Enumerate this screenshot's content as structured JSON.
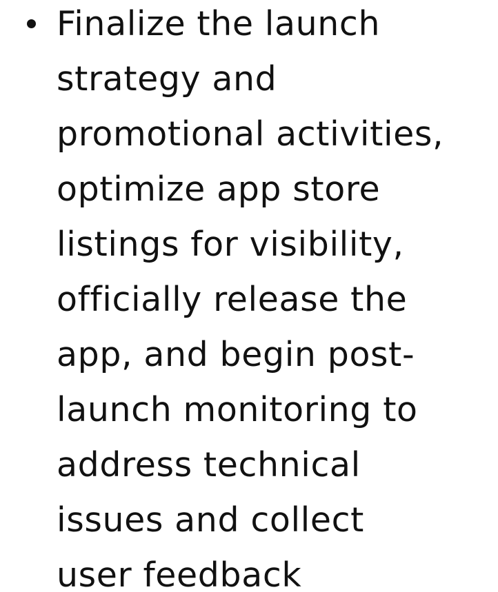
{
  "document": {
    "bullets": [
      {
        "lines": [
          "Finalize the launch",
          "strategy and",
          "promotional activities,",
          "optimize app store",
          "listings for visibility,",
          "officially release the",
          "app, and begin post-",
          "launch monitoring to",
          "address technical",
          "issues and collect",
          "user feedback"
        ]
      }
    ]
  }
}
